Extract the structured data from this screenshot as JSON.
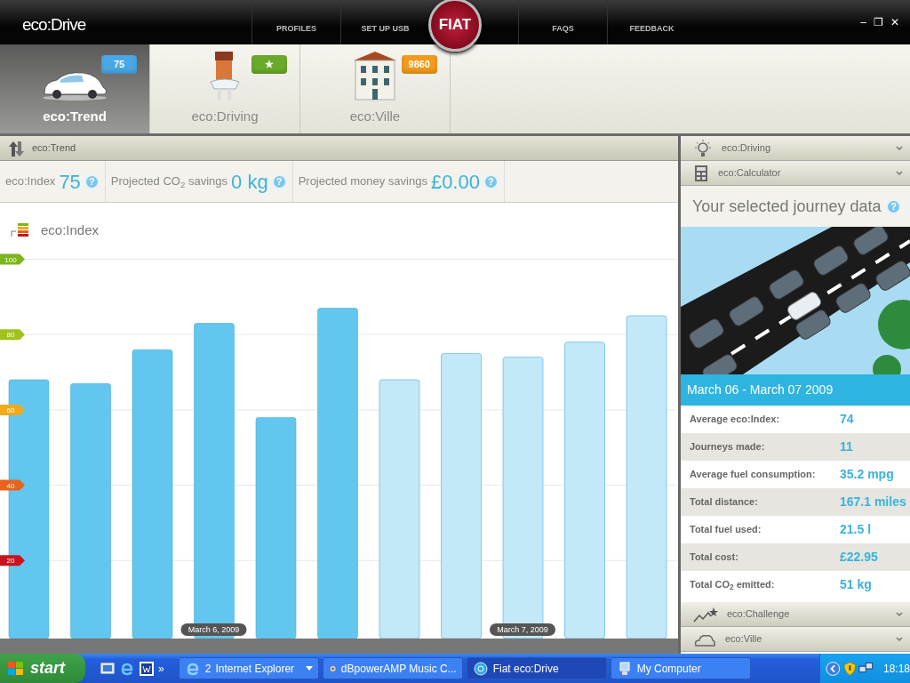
{
  "app": {
    "logo": "eco:Drive",
    "brand": "FIAT"
  },
  "nav": [
    "PROFILES",
    "SET UP USB",
    "FAQS",
    "FEEDBACK"
  ],
  "window_controls": [
    "–",
    "❐",
    "✕"
  ],
  "tabs": [
    {
      "label": "eco:Trend",
      "badge": "75",
      "color": "#4aa8e6",
      "kind": "car",
      "selected": true
    },
    {
      "label": "eco:Driving",
      "badge": "★",
      "color": "#6aaa2a",
      "kind": "character",
      "selected": false
    },
    {
      "label": "eco:Ville",
      "badge": "9860",
      "color": "#f39a1c",
      "kind": "building",
      "selected": false
    }
  ],
  "trend": {
    "title": "eco:Trend",
    "stats": [
      {
        "label": "eco:Index",
        "value": "75",
        "help": "?"
      },
      {
        "label": "Projected CO$_{2}$ savings",
        "value": "0 kg",
        "help": "?"
      },
      {
        "label": "Projected money savings",
        "value": "£0.00",
        "help": "?"
      }
    ],
    "chart_data": {
      "type": "bar",
      "title": "eco:Index",
      "categories": [
        null,
        null,
        null,
        "March 6, 2009",
        null,
        null,
        null,
        null,
        "March 7, 2009",
        null,
        null
      ],
      "series": [
        {
          "color": "#62c6ee",
          "values": [
            68,
            67,
            76,
            83,
            58,
            87,
            null,
            null,
            null,
            null,
            null
          ]
        },
        {
          "color": "#c3e8f7",
          "values": [
            null,
            null,
            null,
            null,
            null,
            null,
            68,
            75,
            74,
            78,
            85
          ]
        }
      ],
      "ylim": [
        0,
        115
      ],
      "yticks": [
        20,
        40,
        60,
        80,
        100
      ],
      "grid": true
    }
  },
  "sidebar": {
    "sections": [
      {
        "title": "eco:Driving",
        "kind": "bulb"
      },
      {
        "title": "eco:Calculator",
        "kind": "calculator"
      }
    ],
    "journey": {
      "title": "Your selected journey data",
      "help": "?",
      "period": "March 06 - March 07 2009",
      "rows": [
        {
          "label": "Average eco:Index:",
          "value": "74"
        },
        {
          "label": "Journeys made:",
          "value": "11"
        },
        {
          "label": "Average fuel consumption:",
          "value": "35.2 mpg"
        },
        {
          "label": "Total distance:",
          "value": "167.1 miles"
        },
        {
          "label": "Total fuel used:",
          "value": "21.5 l"
        },
        {
          "label": "Total cost:",
          "value": "£22.95"
        },
        {
          "label": "Total CO$_{2}$ emitted:",
          "value": "51 kg"
        }
      ]
    },
    "more_sections": [
      {
        "title": "eco:Challenge",
        "kind": "trend"
      },
      {
        "title": "eco:Ville",
        "kind": "cloud"
      }
    ]
  },
  "taskbar": {
    "start": "start",
    "more": "»",
    "tasks": [
      {
        "label": "Internet Explorer",
        "count": "2",
        "kind": "ie",
        "selected": false
      },
      {
        "label": "dBpowerAMP Music C...",
        "kind": "disc",
        "selected": false
      },
      {
        "label": "Fiat eco:Drive",
        "kind": "app",
        "selected": true
      },
      {
        "label": "My Computer",
        "kind": "computer",
        "selected": false
      }
    ],
    "clock": "18:18"
  }
}
